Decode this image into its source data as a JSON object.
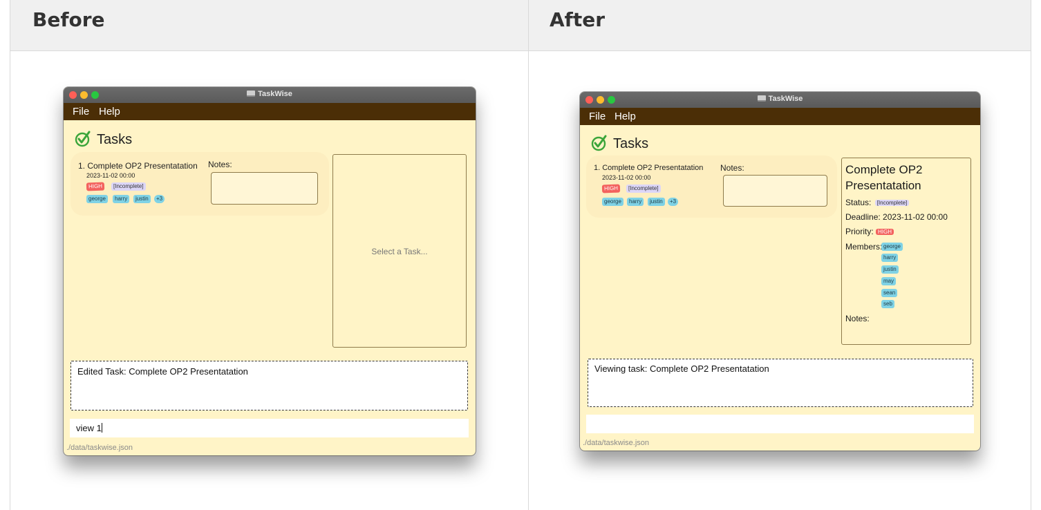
{
  "columns": {
    "before": "Before",
    "after": "After"
  },
  "app": {
    "title": "TaskWise",
    "menu": [
      "File",
      "Help"
    ],
    "section_title": "Tasks",
    "storage_path": "./data/taskwise.json"
  },
  "task": {
    "name": "1. Complete OP2 Presentatation",
    "deadline": "2023-11-02 00:00",
    "priority": "HIGH",
    "status": "[Incomplete]",
    "members_visible": [
      "george",
      "harry",
      "justin"
    ],
    "more_members": "+3",
    "notes_label": "Notes:"
  },
  "before": {
    "detail_placeholder": "Select a Task...",
    "result": "Edited Task: Complete OP2 Presentatation",
    "command": "view 1"
  },
  "after": {
    "result": "Viewing task: Complete OP2 Presentatation",
    "command": "",
    "detail": {
      "title": "Complete OP2 Presentatation",
      "status_label": "Status:",
      "status": "[Incomplete]",
      "deadline_label": "Deadline:",
      "deadline": "2023-11-02 00:00",
      "priority_label": "Priority:",
      "priority": "HIGH",
      "members_label": "Members:",
      "members": [
        "george",
        "harry",
        "justin",
        "may",
        "sean",
        "seb"
      ],
      "notes_label": "Notes:"
    }
  },
  "colors": {
    "window_bg": "#fff4c7",
    "menubar": "#4b2e06",
    "priority_high": "#f3625e",
    "status_tag": "#dcd6f7",
    "member_tag": "#7fd2e5"
  }
}
